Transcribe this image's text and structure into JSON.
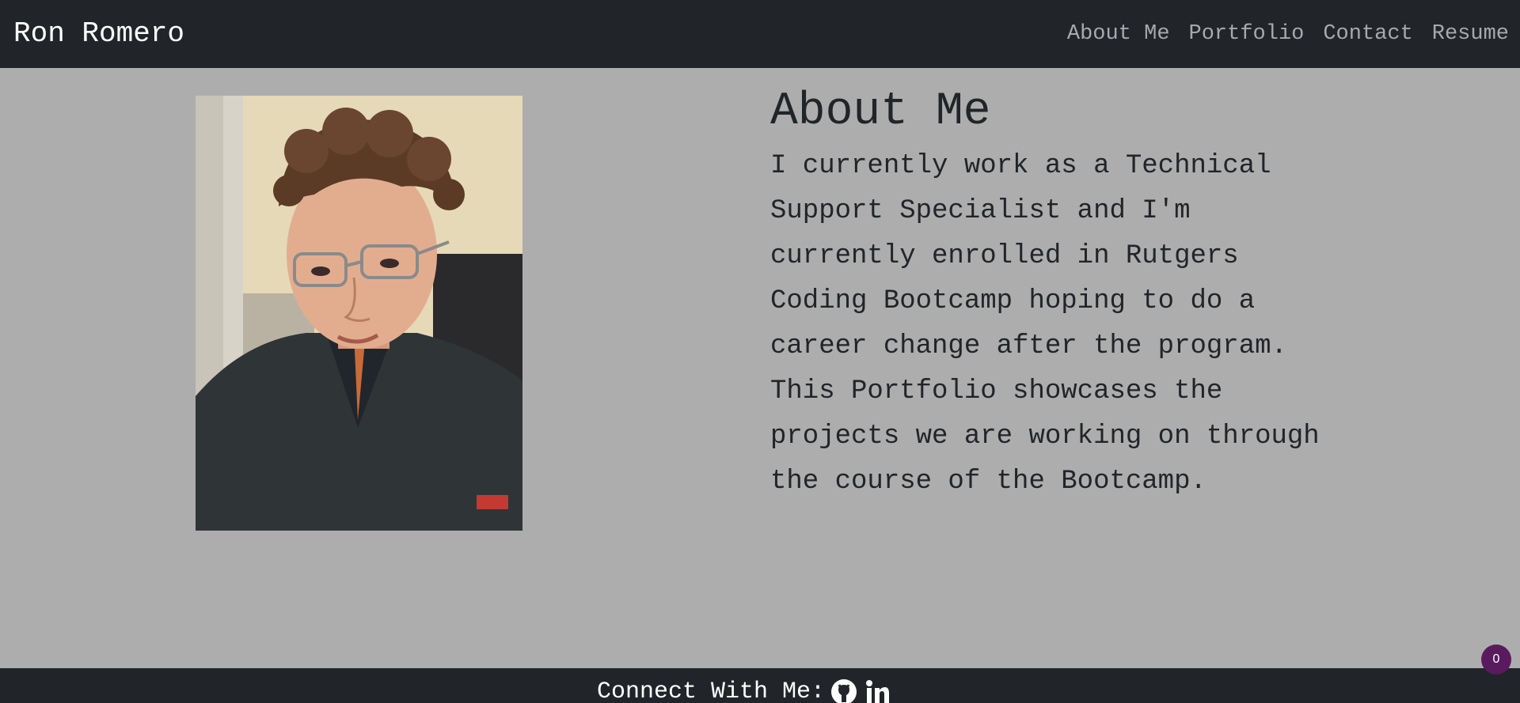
{
  "navbar": {
    "brand": "Ron Romero",
    "links": [
      {
        "label": "About Me"
      },
      {
        "label": "Portfolio"
      },
      {
        "label": "Contact"
      },
      {
        "label": "Resume"
      }
    ]
  },
  "about": {
    "heading": "About Me",
    "body": "I currently work as a Technical Support Specialist and I'm currently enrolled in Rutgers Coding Bootcamp hoping to do a career change after the program. This Portfolio showcases the projects we are working on through the course of the Bootcamp."
  },
  "photo": {
    "alt": "profile-photo"
  },
  "footer": {
    "label": "Connect With Me:",
    "icons": [
      "github-icon",
      "linkedin-icon"
    ]
  },
  "badge": {
    "count": "0"
  },
  "colors": {
    "navbar_bg": "#212529",
    "page_bg": "#adadad",
    "nav_link": "#a8a9ab",
    "badge_bg": "#5a1a5e"
  }
}
